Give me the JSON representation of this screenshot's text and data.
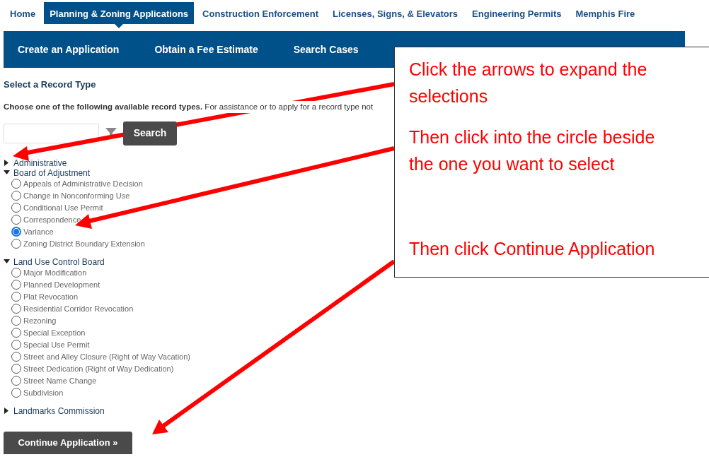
{
  "top_nav": [
    {
      "label": "Home",
      "selected": false
    },
    {
      "label": "Planning & Zoning Applications",
      "selected": true
    },
    {
      "label": "Construction Enforcement",
      "selected": false
    },
    {
      "label": "Licenses, Signs, & Elevators",
      "selected": false
    },
    {
      "label": "Engineering Permits",
      "selected": false
    },
    {
      "label": "Memphis Fire",
      "selected": false
    }
  ],
  "sub_nav": [
    "Create an Application",
    "Obtain a Fee Estimate",
    "Search Cases"
  ],
  "heading": "Select a Record Type",
  "intro": "**Choose one of the following available record types.** For assistance or to apply for a record type not",
  "search_button": "Search",
  "tree": [
    {
      "label": "Administrative",
      "expanded": false
    },
    {
      "label": "Board of Adjustment",
      "expanded": true,
      "children": [
        {
          "label": "Appeals of Administrative Decision",
          "selected": false
        },
        {
          "label": "Change in Nonconforming Use",
          "selected": false
        },
        {
          "label": "Conditional Use Permit",
          "selected": false
        },
        {
          "label": "Correspondence",
          "selected": false
        },
        {
          "label": "Variance",
          "selected": true
        },
        {
          "label": "Zoning District Boundary Extension",
          "selected": false
        }
      ]
    },
    {
      "label": "Land Use Control Board",
      "expanded": true,
      "children": [
        {
          "label": "Major Modification",
          "selected": false
        },
        {
          "label": "Planned Development",
          "selected": false
        },
        {
          "label": "Plat Revocation",
          "selected": false
        },
        {
          "label": "Residential Corridor Revocation",
          "selected": false
        },
        {
          "label": "Rezoning",
          "selected": false
        },
        {
          "label": "Special Exception",
          "selected": false
        },
        {
          "label": "Special Use Permit",
          "selected": false
        },
        {
          "label": "Street and Alley Closure (Right of Way Vacation)",
          "selected": false
        },
        {
          "label": "Street Dedication (Right of Way Dedication)",
          "selected": false
        },
        {
          "label": "Street Name Change",
          "selected": false
        },
        {
          "label": "Subdivision",
          "selected": false
        }
      ]
    },
    {
      "label": "Landmarks Commission",
      "expanded": false
    }
  ],
  "continue_button": "Continue Application »",
  "callout": [
    "Click the arrows to expand the selections",
    "Then click into the circle beside the one you want to select",
    "Then click Continue Application"
  ]
}
